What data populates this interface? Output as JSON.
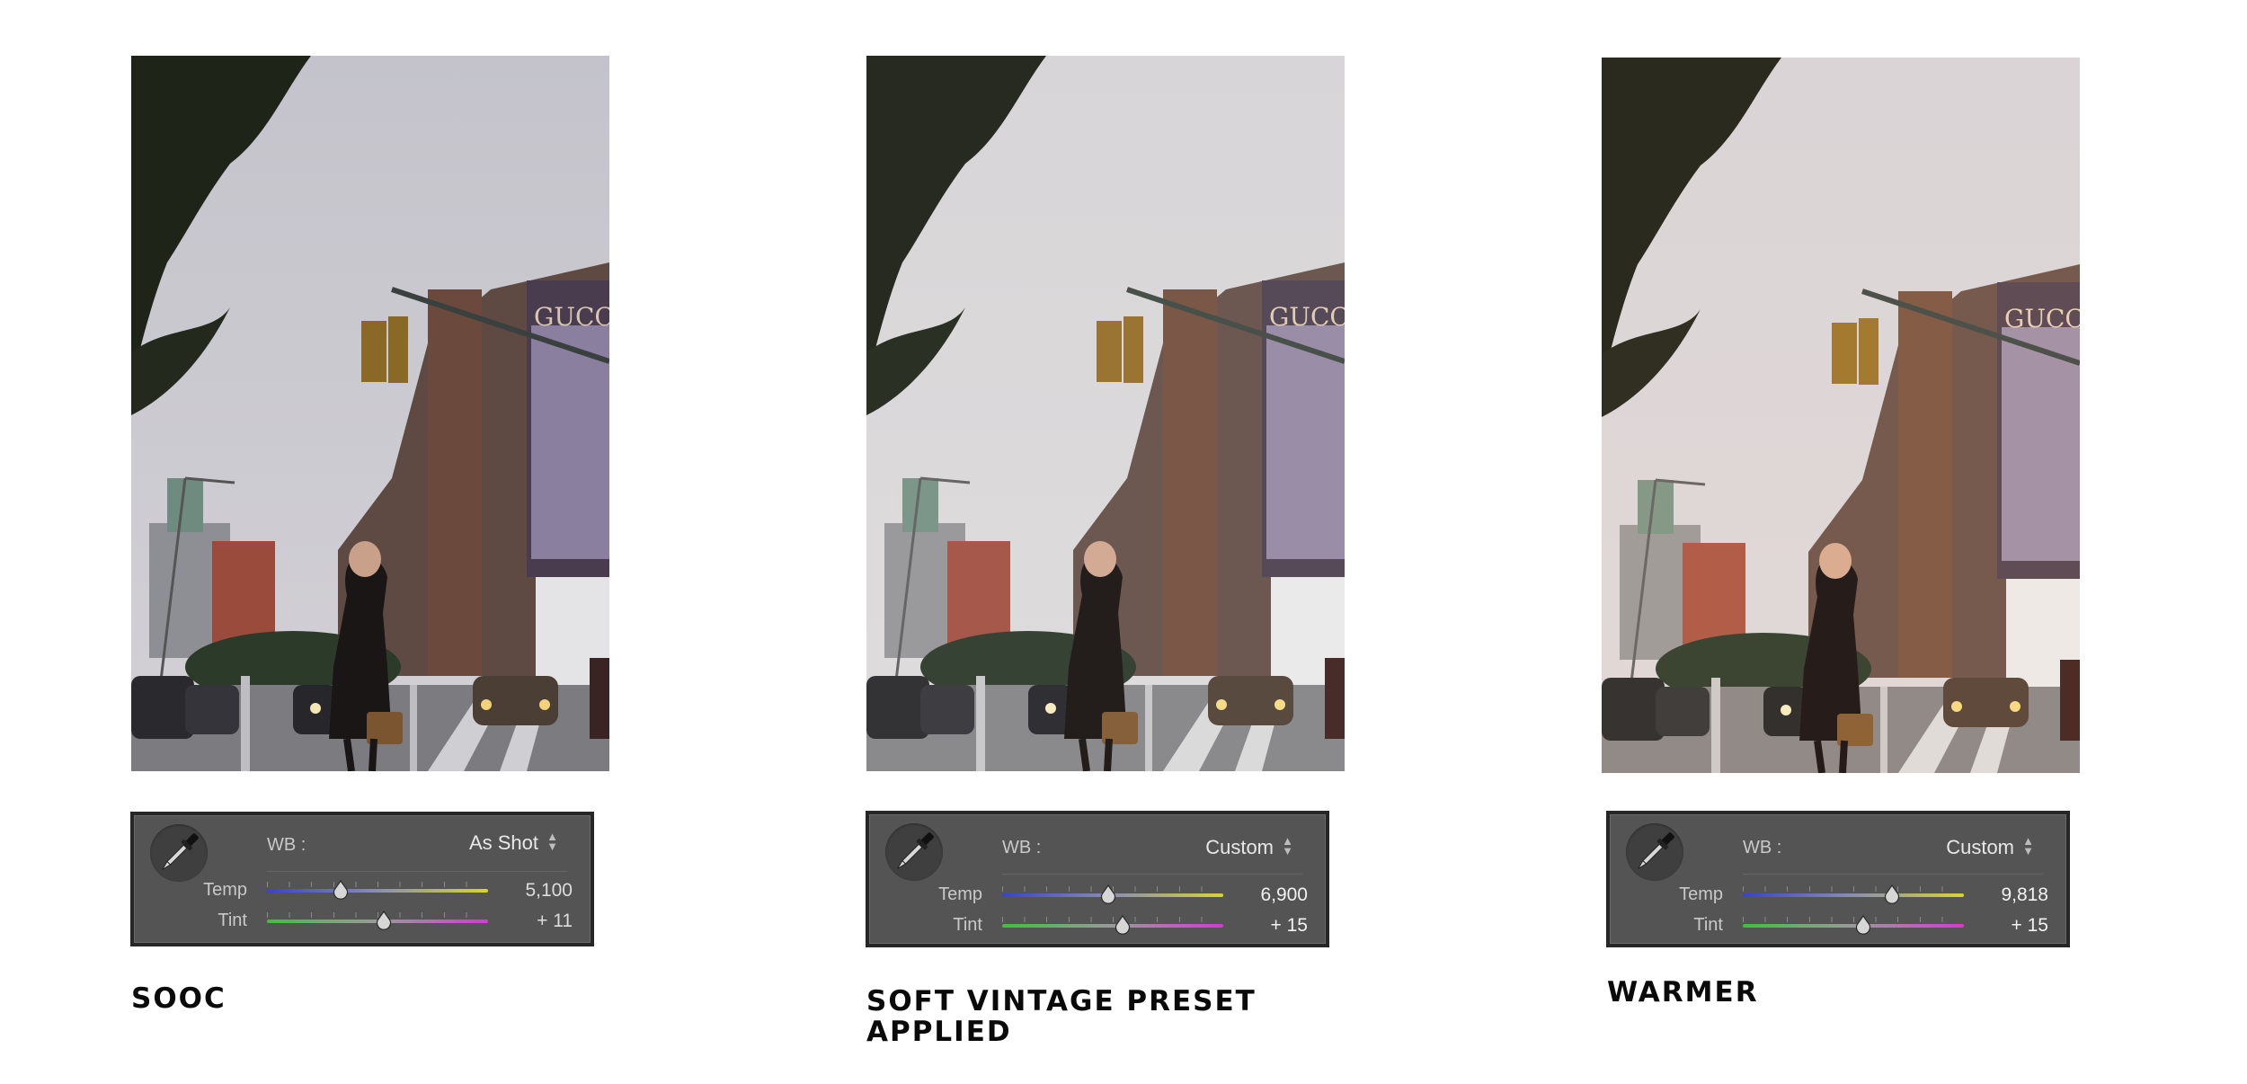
{
  "panels": [
    {
      "caption": "SOOC",
      "wb_label": "WB :",
      "wb_mode": "As Shot",
      "temp_label": "Temp",
      "temp_value": "5,100",
      "tint_label": "Tint",
      "tint_value": "+ 11"
    },
    {
      "caption": "SOFT VINTAGE PRESET APPLIED",
      "wb_label": "WB :",
      "wb_mode": "Custom",
      "temp_label": "Temp",
      "temp_value": "6,900",
      "tint_label": "Tint",
      "tint_value": "+ 15"
    },
    {
      "caption": "WARMER",
      "wb_label": "WB :",
      "wb_mode": "Custom",
      "temp_label": "Temp",
      "temp_value": "9,818",
      "tint_label": "Tint",
      "tint_value": "+ 15"
    }
  ],
  "billboard_text": "GUCCI",
  "colors": {
    "panel_bg": "#545454",
    "panel_border": "#262626",
    "caption": "#0a0a0a"
  },
  "icons": {
    "eyedropper": "eyedropper-icon",
    "slider_thumb": "slider-thumb-icon",
    "dropdown_arrows": "up-down-arrows-icon"
  }
}
